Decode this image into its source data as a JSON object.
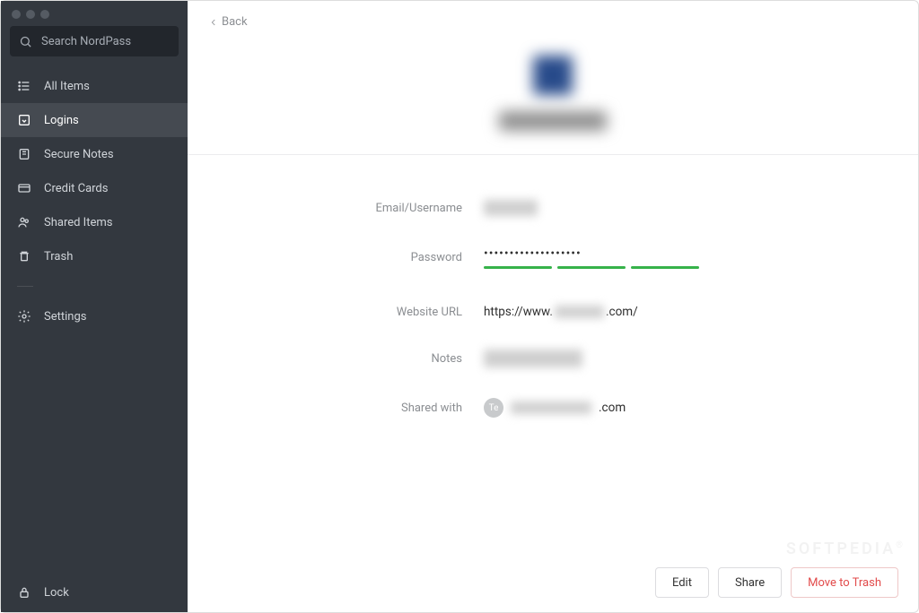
{
  "sidebar": {
    "search_placeholder": "Search NordPass",
    "items": [
      {
        "label": "All Items"
      },
      {
        "label": "Logins"
      },
      {
        "label": "Secure Notes"
      },
      {
        "label": "Credit Cards"
      },
      {
        "label": "Shared Items"
      },
      {
        "label": "Trash"
      }
    ],
    "settings_label": "Settings",
    "lock_label": "Lock"
  },
  "header": {
    "back_label": "Back"
  },
  "detail": {
    "labels": {
      "email_username": "Email/Username",
      "password": "Password",
      "website_url": "Website URL",
      "notes": "Notes",
      "shared_with": "Shared with"
    },
    "password_masked": "•••••••••••••••••••",
    "website_prefix": "https://www.",
    "website_suffix": ".com/",
    "shared_avatar_initials": "Te",
    "shared_suffix": ".com"
  },
  "actions": {
    "edit": "Edit",
    "share": "Share",
    "move_to_trash": "Move to Trash"
  },
  "watermark": "SOFTPEDIA"
}
